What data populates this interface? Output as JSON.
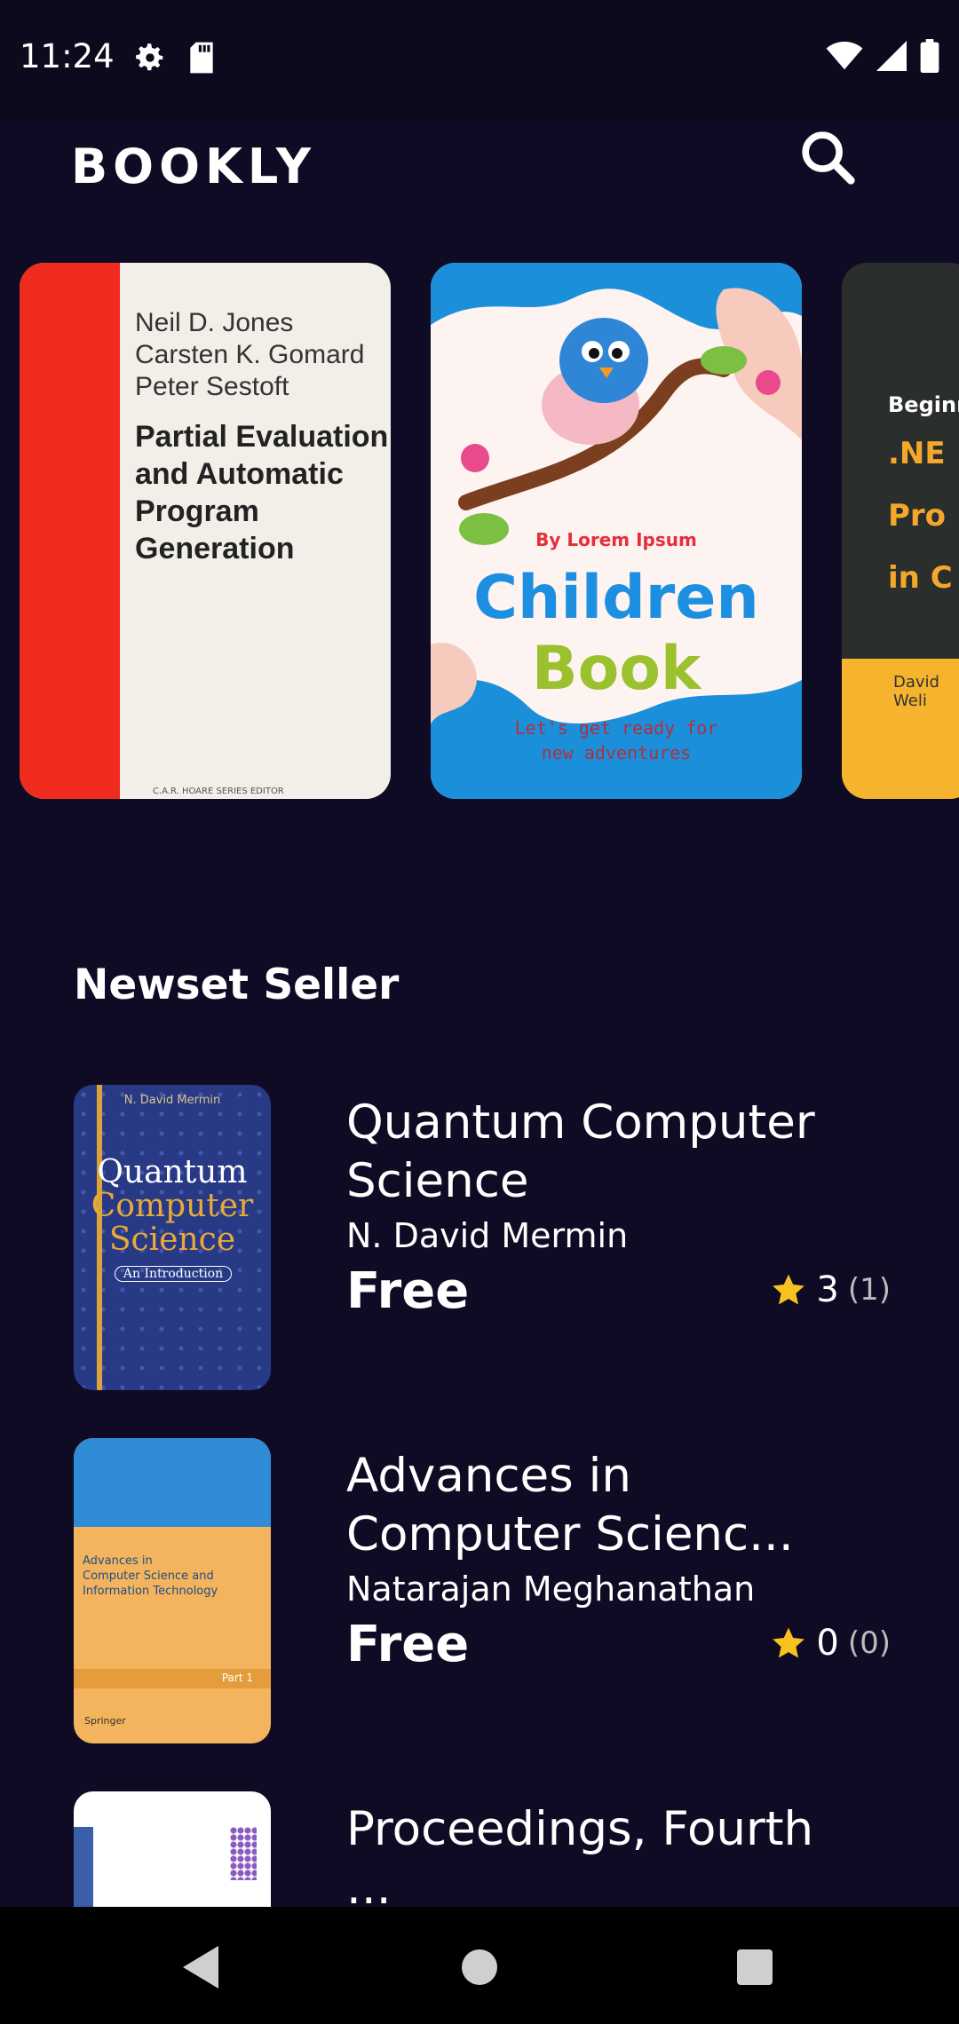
{
  "status": {
    "time": "11:24",
    "left_icons": [
      "gear-icon",
      "sd-card-icon"
    ],
    "right_icons": [
      "wifi-icon",
      "signal-icon",
      "battery-icon"
    ]
  },
  "app": {
    "logo_text": "BOOKLY",
    "search_icon": "search-icon"
  },
  "carousel": [
    {
      "authors": [
        "Neil D. Jones",
        "Carsten K. Gomard",
        "Peter Sestoft"
      ],
      "title": [
        "Partial Evaluation",
        "and Automatic",
        "Program Generation"
      ],
      "publisher": "C.A.R. HOARE SERIES EDITOR"
    },
    {
      "byline": "By Lorem Ipsum",
      "title_line1": "Children",
      "title_line2": "Book",
      "tagline": [
        "Let's get ready for",
        "new adventures"
      ]
    },
    {
      "title": [
        "Beginn",
        ".NE",
        "Pro",
        "in C"
      ],
      "authors": "David Weli"
    }
  ],
  "section": {
    "title": "Newset Seller"
  },
  "books": [
    {
      "title": "Quantum Computer Science",
      "author": "N. David Mermin",
      "price": "Free",
      "rating": "3",
      "count": "(1)",
      "cover": {
        "author": "N. David Mermin",
        "title": [
          "Quantum",
          "Computer",
          "Science"
        ],
        "subtitle": "An Introduction"
      }
    },
    {
      "title": "Advances in Computer Scienc...",
      "author": "Natarajan Meghanathan",
      "price": "Free",
      "rating": "0",
      "count": "(0)",
      "cover": {
        "title": [
          "Advances in",
          "Computer Science and",
          "Information Technology"
        ],
        "part": "Part 1",
        "publisher": "Springer"
      }
    },
    {
      "title": "Proceedings, Fourth ...",
      "author": "",
      "price": "",
      "rating": "",
      "count": ""
    }
  ],
  "colors": {
    "background": "#100b24",
    "star": "#f7c21f"
  }
}
